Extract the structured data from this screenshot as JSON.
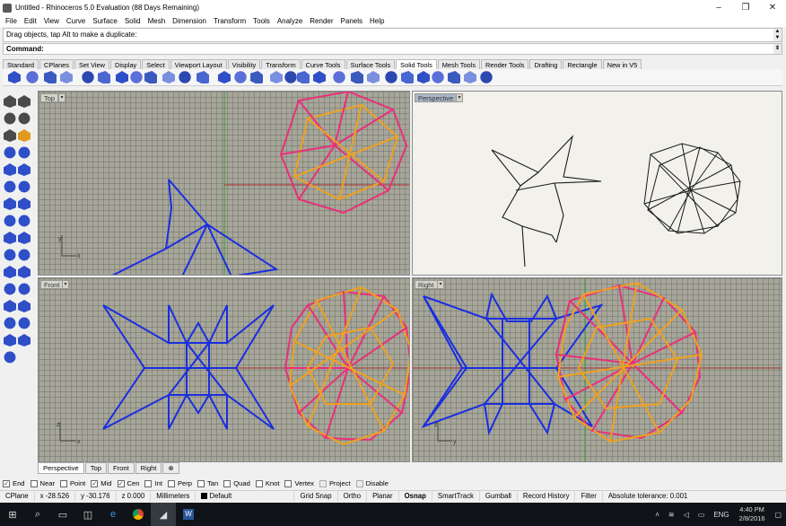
{
  "window": {
    "title": "Untitled - Rhinoceros 5.0 Evaluation (88 Days Remaining)",
    "minimize": "–",
    "maximize": "❐",
    "close": "✕"
  },
  "menu": [
    "File",
    "Edit",
    "View",
    "Curve",
    "Surface",
    "Solid",
    "Mesh",
    "Dimension",
    "Transform",
    "Tools",
    "Analyze",
    "Render",
    "Panels",
    "Help"
  ],
  "history_text": "Drag objects, tap Alt to make a duplicate:",
  "command_label": "Command:",
  "toolbar_tabs": [
    "Standard",
    "CPlanes",
    "Set View",
    "Display",
    "Select",
    "Viewport Layout",
    "Visibility",
    "Transform",
    "Curve Tools",
    "Surface Tools",
    "Solid Tools",
    "Mesh Tools",
    "Render Tools",
    "Drafting",
    "Rectangle",
    "New in V5"
  ],
  "active_toolbar_tab": "Solid Tools",
  "viewports": {
    "top": {
      "label": "Top"
    },
    "perspective": {
      "label": "Perspective"
    },
    "front": {
      "label": "Front"
    },
    "right": {
      "label": "Right"
    },
    "axis": {
      "x": "x",
      "y": "y",
      "z": "z"
    }
  },
  "viewport_tabs": [
    "Perspective",
    "Top",
    "Front",
    "Right",
    "⊕"
  ],
  "osnaps": [
    {
      "label": "End",
      "checked": true
    },
    {
      "label": "Near",
      "checked": false
    },
    {
      "label": "Point",
      "checked": false
    },
    {
      "label": "Mid",
      "checked": true
    },
    {
      "label": "Cen",
      "checked": true
    },
    {
      "label": "Int",
      "checked": false
    },
    {
      "label": "Perp",
      "checked": false
    },
    {
      "label": "Tan",
      "checked": false
    },
    {
      "label": "Quad",
      "checked": false
    },
    {
      "label": "Knot",
      "checked": false
    },
    {
      "label": "Vertex",
      "checked": false
    },
    {
      "label": "Project",
      "checked": false
    },
    {
      "label": "Disable",
      "checked": false
    }
  ],
  "status": {
    "cplane": "CPlane",
    "x": "x -28.526",
    "y": "y -30.176",
    "z": "z 0.000",
    "units": "Millimeters",
    "layer": "Default",
    "toggles": [
      "Grid Snap",
      "Ortho",
      "Planar",
      "Osnap",
      "SmartTrack",
      "Gumball",
      "Record History",
      "Filter"
    ],
    "tolerance": "Absolute tolerance: 0.001"
  },
  "taskbar": {
    "lang": "ENG",
    "time": "4:40 PM",
    "date": "2/8/2016"
  },
  "colors": {
    "blue_curve": "#1a2ee0",
    "pink_curve": "#e8307a",
    "orange_curve": "#f0a020",
    "axis_red": "#a83030",
    "axis_green": "#30a030"
  }
}
